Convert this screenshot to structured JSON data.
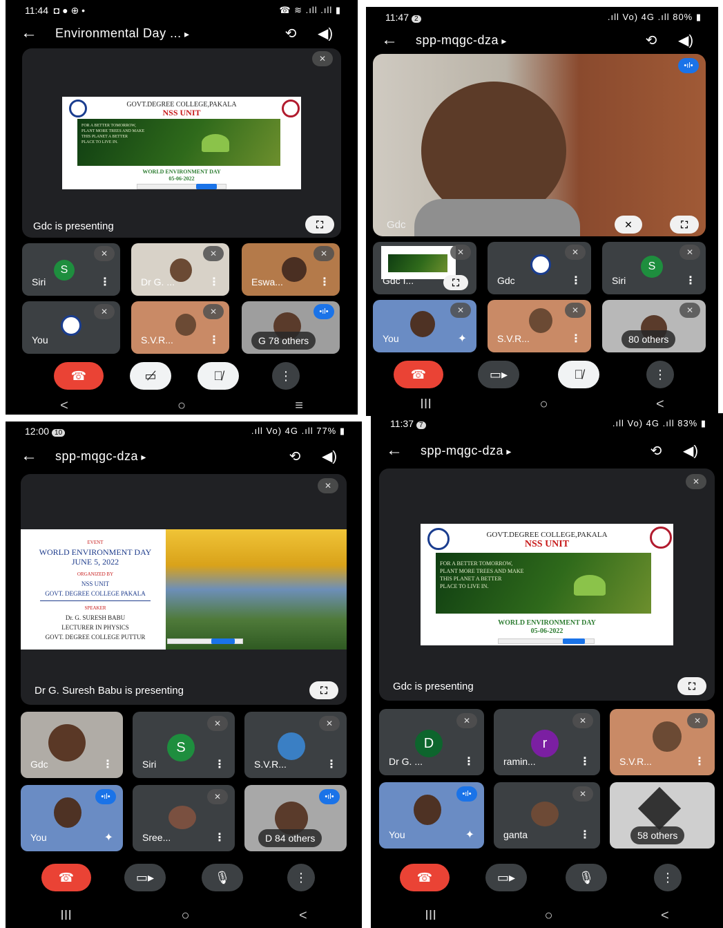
{
  "colors": {
    "end_call": "#ea4335",
    "speaking": "#1a73e8",
    "siri_avatar": "#1e8e3e",
    "d_avatar": "#0d652d",
    "r_avatar": "#7b1fa2",
    "tile_bg": "#3c4043"
  },
  "panel1": {
    "time": "11:44",
    "status_left_icons": "◘ ● ⊕ •",
    "status_right": "☎ ≋ .ıll .ıll ▮",
    "meeting_title": "Environmental Day ...",
    "presenting_label": "Gdc is presenting",
    "slide": {
      "college": "GOVT.DEGREE COLLEGE,PAKALA",
      "unit": "NSS UNIT",
      "banner": [
        "FOR A BETTER TOMORROW,",
        "PLANT MORE TREES AND MAKE",
        "THIS PLANET A BETTER",
        "PLACE TO LIVE IN."
      ],
      "event": "WORLD ENVIRONMENT DAY",
      "date": "05-06-2022",
      "stop_sharing": "Stop sharing"
    },
    "tiles": [
      {
        "name": "Siri",
        "avatar_letter": "S"
      },
      {
        "name": "Dr G. ..."
      },
      {
        "name": "Eswa..."
      },
      {
        "name": "You"
      },
      {
        "name": "S.V.R..."
      },
      {
        "name": "G",
        "others": "78 others"
      }
    ],
    "nav": [
      "<",
      "○",
      "≡"
    ]
  },
  "panel2": {
    "time": "11:47",
    "badge": "2",
    "status_right": ".ıll Vo) 4G .ıll 80% ▮",
    "meeting_title": "spp-mqgc-dza",
    "main_name": "Gdc",
    "tiles": [
      {
        "name": "Gdc I..."
      },
      {
        "name": "Gdc"
      },
      {
        "name": "Siri",
        "avatar_letter": "S"
      },
      {
        "name": "You"
      },
      {
        "name": "S.V.R..."
      },
      {
        "name": "",
        "others": "80 others"
      }
    ],
    "nav": [
      "III",
      "○",
      "<"
    ]
  },
  "panel3": {
    "time": "12:00",
    "badge": "10",
    "status_right": ".ıll Vo) 4G .ıll 77% ▮",
    "meeting_title": "spp-mqgc-dza",
    "presenting_label": "Dr G. Suresh Babu is presenting",
    "slide": {
      "event_label": "EVENT",
      "event": "WORLD ENVIRONMENT DAY",
      "date": "JUNE 5, 2022",
      "organized_by": "ORGANIZED BY",
      "organizer1": "NSS UNIT",
      "organizer2": "GOVT. DEGREE COLLEGE PAKALA",
      "speaker_label": "SPEAKER",
      "speaker": "Dr. G. SURESH BABU",
      "speaker_title": "LECTURER IN PHYSICS",
      "speaker_college": "GOVT. DEGREE COLLEGE PUTTUR",
      "stop_sharing": "Stop sharing"
    },
    "tiles": [
      {
        "name": "Gdc"
      },
      {
        "name": "Siri",
        "avatar_letter": "S"
      },
      {
        "name": "S.V.R..."
      },
      {
        "name": "You"
      },
      {
        "name": "Sree..."
      },
      {
        "name": "D",
        "others": "84 others"
      }
    ],
    "nav": [
      "III",
      "○",
      "<"
    ]
  },
  "panel4": {
    "time": "11:37",
    "badge": "7",
    "status_right": ".ıll Vo) 4G .ıll 83% ▮",
    "meeting_title": "spp-mqgc-dza",
    "presenting_label": "Gdc is presenting",
    "slide": {
      "college": "GOVT.DEGREE COLLEGE,PAKALA",
      "unit": "NSS UNIT",
      "banner": [
        "FOR A BETTER TOMORROW,",
        "PLANT MORE TREES AND MAKE",
        "THIS PLANET A BETTER",
        "PLACE TO LIVE IN."
      ],
      "event": "WORLD ENVIRONMENT DAY",
      "date": "05-06-2022",
      "stop_sharing": "Stop sharing"
    },
    "tiles": [
      {
        "name": "Dr G. ...",
        "avatar_letter": "D"
      },
      {
        "name": "ramin...",
        "avatar_letter": "r"
      },
      {
        "name": "S.V.R..."
      },
      {
        "name": "You"
      },
      {
        "name": "ganta"
      },
      {
        "name": "",
        "others": "58 others"
      }
    ],
    "nav": [
      "III",
      "○",
      "<"
    ]
  },
  "icons": {
    "back": "←",
    "camera_flip": "⟲",
    "speaker": "◀)",
    "mic_off": "🎙̸",
    "more": "⋮",
    "expand": "⛶",
    "end_call": "☎",
    "camera": "▭▸",
    "camera_off": "▭̸",
    "mic": "🎙",
    "sparkle": "✦",
    "speaking": "•ıl•"
  }
}
